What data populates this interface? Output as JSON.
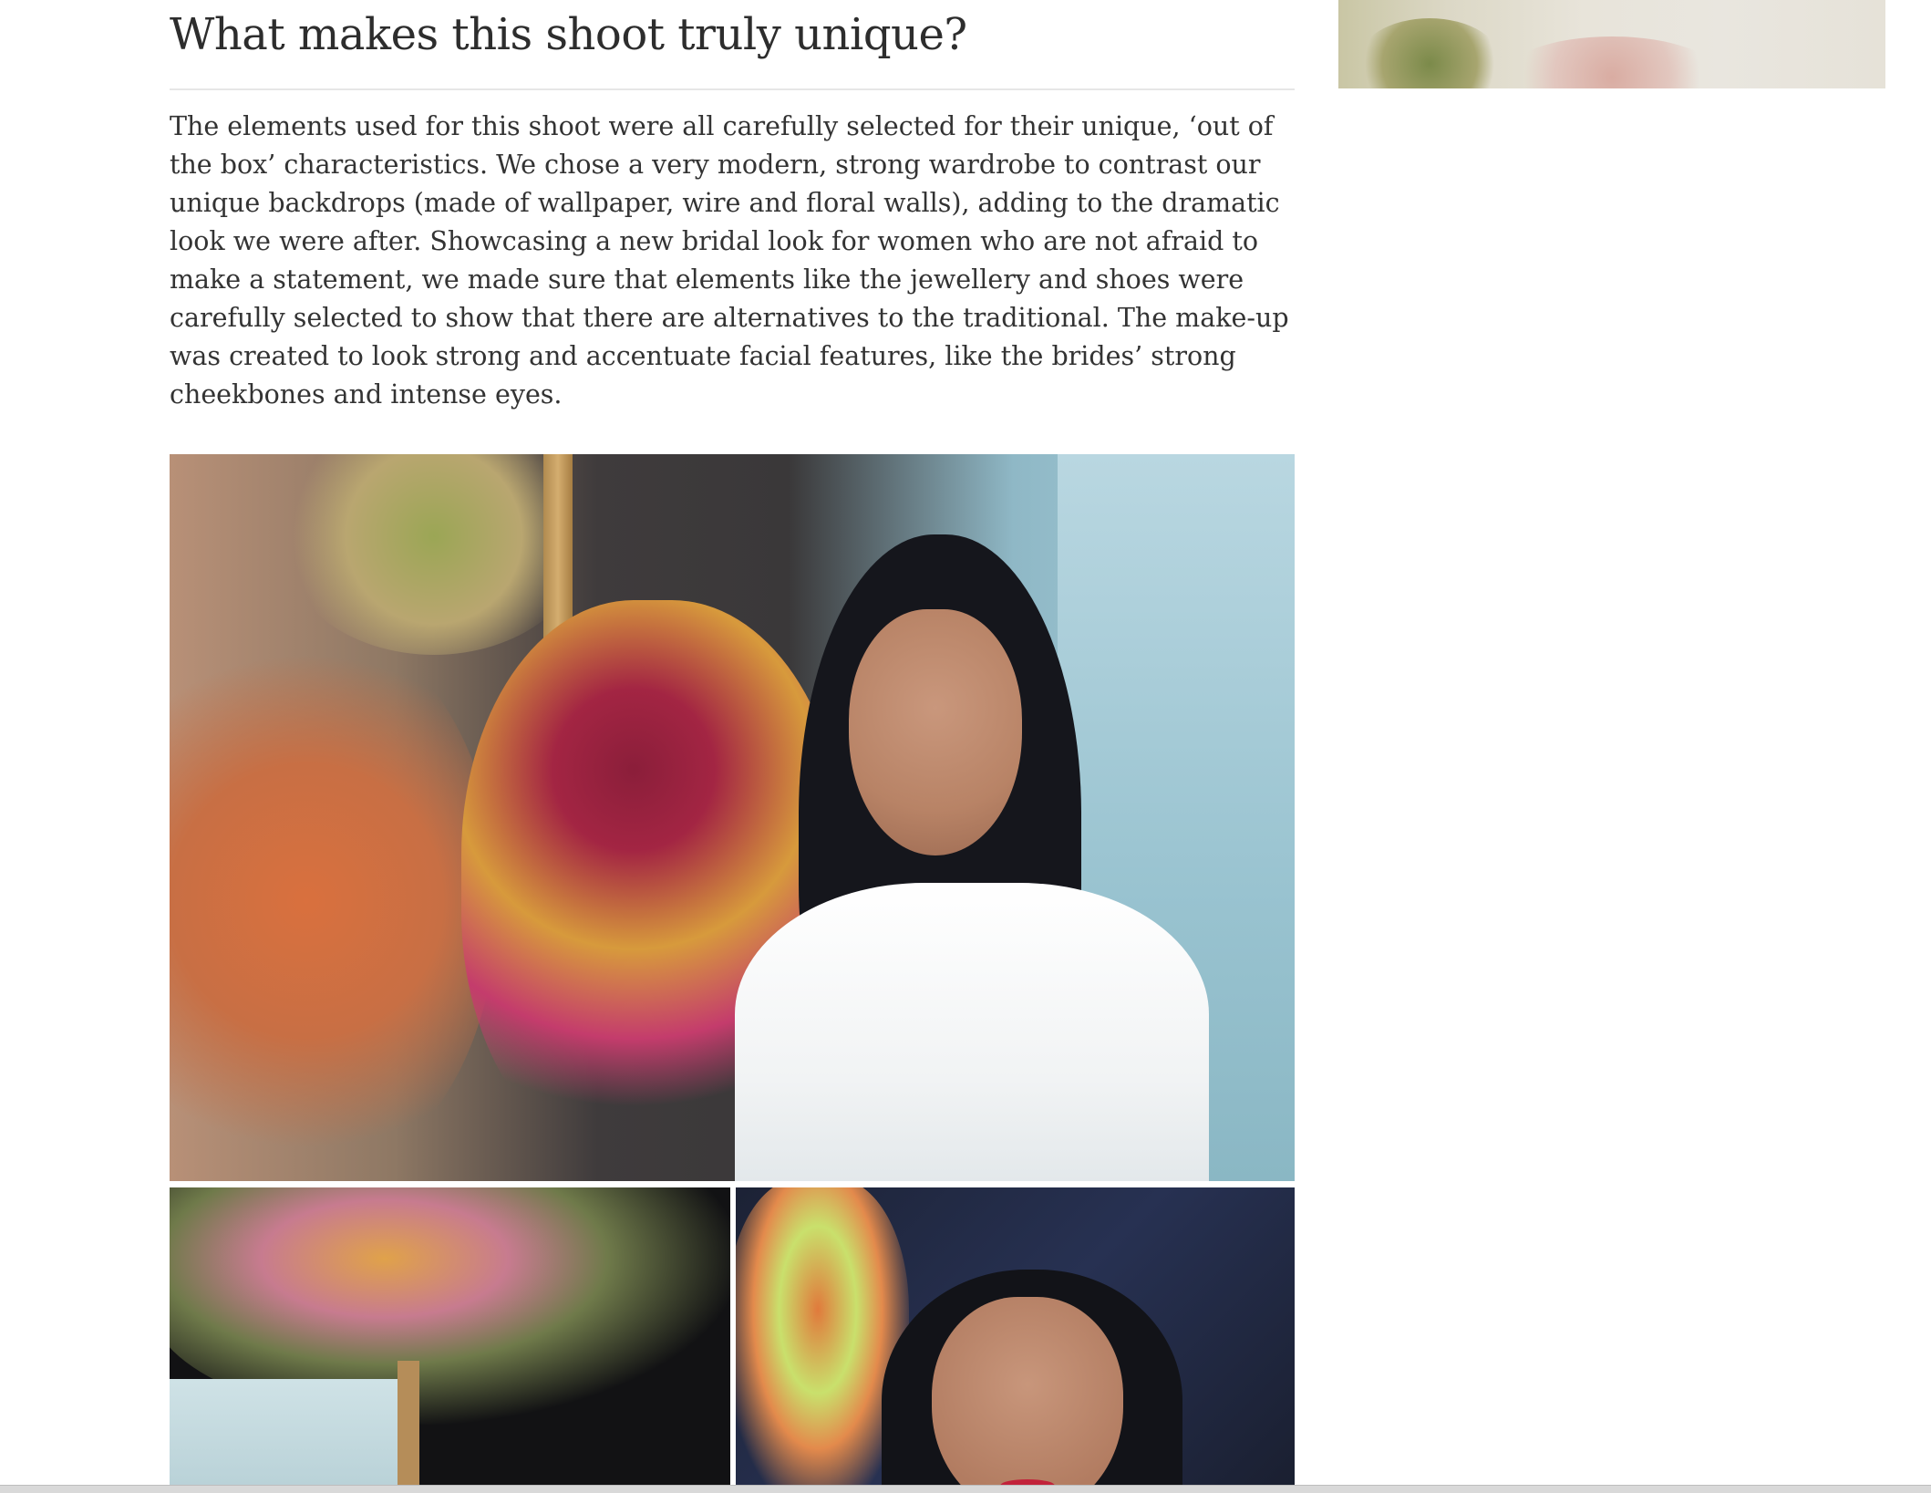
{
  "article": {
    "title": "What makes this shoot truly unique?",
    "body": "The elements used for this shoot were all carefully selected for their unique, ‘out of the box’ characteristics. We chose a very modern, strong wardrobe to contrast our unique backdrops (made of wallpaper, wire and floral walls), adding to the dramatic look we were after. Showcasing a new bridal look for women who are not afraid to make a statement, we made sure that elements like the jewellery and shoes were carefully selected to show that there are alternatives to the traditional. The make-up was created to look strong and accentuate facial features, like the brides’ strong cheekbones and intense eyes."
  },
  "colors": {
    "text": "#333333",
    "heading": "#2d2d2d",
    "divider": "#e6e6e6",
    "background": "#ffffff"
  }
}
